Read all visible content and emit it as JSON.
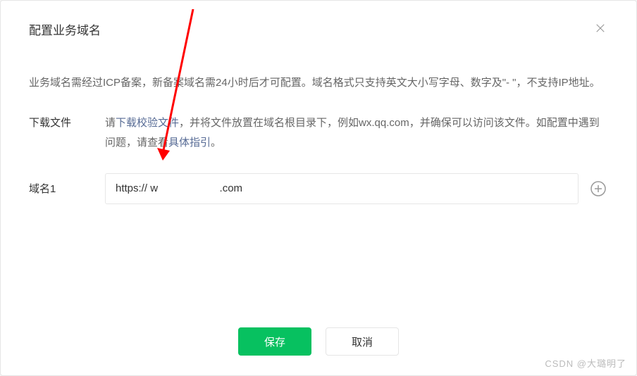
{
  "modal": {
    "title": "配置业务域名",
    "description": "业务域名需经过ICP备案，新备案域名需24小时后才可配置。域名格式只支持英文大小写字母、数字及\"- \"，不支持IP地址。"
  },
  "download": {
    "label": "下载文件",
    "text_before": "请",
    "link_text": "下载校验文件",
    "text_after1": "，并将文件放置在域名根目录下，例如wx.qq.com，并确保可以访问该文件。如配置中遇到问题，请查看",
    "guide_link": "具体指引",
    "text_after2": "。"
  },
  "domain": {
    "label": "域名1",
    "value": "https:// w                     .com"
  },
  "buttons": {
    "save": "保存",
    "cancel": "取消"
  },
  "watermark": "CSDN @大璐明了"
}
